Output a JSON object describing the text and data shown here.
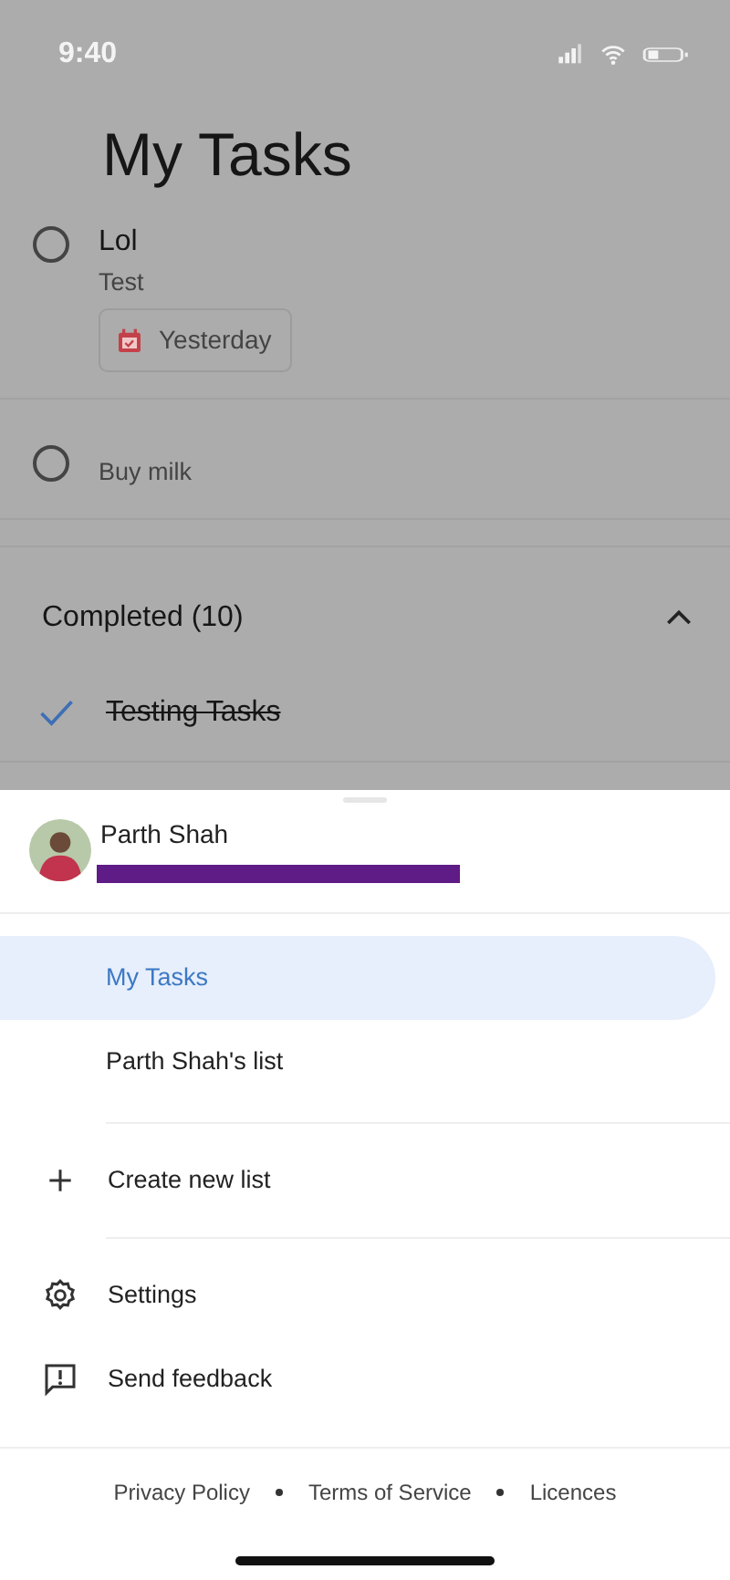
{
  "status_bar": {
    "time": "9:40"
  },
  "title": "My Tasks",
  "tasks": [
    {
      "title": "Lol",
      "notes": "Test",
      "due": "Yesterday",
      "completed": false
    },
    {
      "notes": "Buy milk",
      "completed": false
    }
  ],
  "completed_section": {
    "label": "Completed (10)",
    "expanded": true,
    "tasks": [
      {
        "title": "Testing Tasks",
        "completed": true
      }
    ]
  },
  "sheet": {
    "account": {
      "name": "Parth Shah"
    },
    "lists": [
      {
        "label": "My Tasks",
        "selected": true
      },
      {
        "label": "Parth Shah's list",
        "selected": false
      }
    ],
    "actions": [
      {
        "kind": "create",
        "label": "Create new list"
      },
      {
        "kind": "settings",
        "label": "Settings"
      },
      {
        "kind": "feedback",
        "label": "Send feedback"
      }
    ],
    "footer_links": [
      "Privacy Policy",
      "Terms of Service",
      "Licences"
    ]
  }
}
